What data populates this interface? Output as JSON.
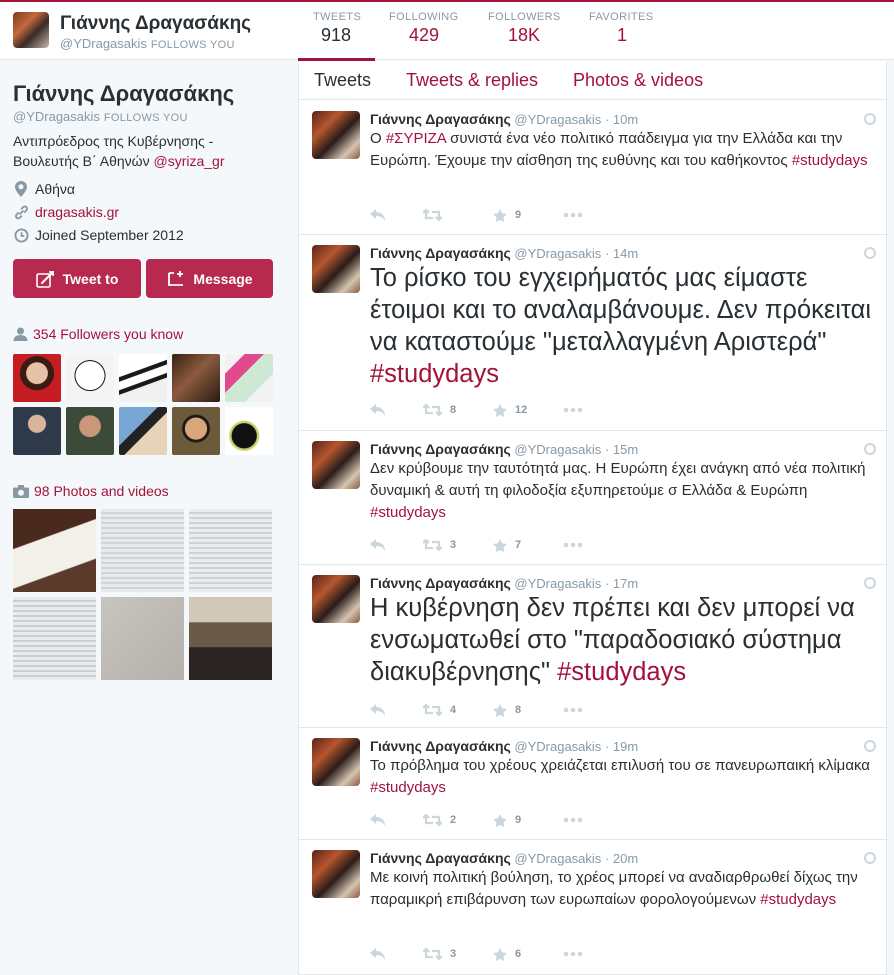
{
  "header": {
    "name": "Γιάννης Δραγασάκης",
    "handle": "@YDragasakis",
    "follows_you": "FOLLOWS YOU",
    "stats": [
      {
        "label": "TWEETS",
        "value": "918"
      },
      {
        "label": "FOLLOWING",
        "value": "429"
      },
      {
        "label": "FOLLOWERS",
        "value": "18K"
      },
      {
        "label": "FAVORITES",
        "value": "1"
      }
    ]
  },
  "profile": {
    "name": "Γιάννης Δραγασάκης",
    "handle": "@YDragasakis",
    "follows_you": "FOLLOWS YOU",
    "bio_line1": "Αντιπρόεδρος της Κυβέρνησης -",
    "bio_line2": "Βουλευτής Β΄ Αθηνών",
    "bio_mention": "@syriza_gr",
    "location": "Αθήνα",
    "website": "dragasakis.gr",
    "joined": "Joined September 2012",
    "tweet_to_label": "Tweet to",
    "message_label": "Message",
    "followers_you_know": "354 Followers you know",
    "photos_videos": "98 Photos and videos"
  },
  "tabs": [
    {
      "label": "Tweets"
    },
    {
      "label": "Tweets & replies"
    },
    {
      "label": "Photos & videos"
    }
  ],
  "tweets": [
    {
      "name": "Γιάννης Δραγασάκης",
      "handle": "@YDragasakis",
      "time": "· 10m",
      "parts": [
        "Ο ",
        "#ΣΥΡΙΖΑ",
        " συνιστά ένα νέο πολιτικό παάδειγμα για την Ελλάδα και την Ευρώπη. Έχουμε την αίσθηση της ευθύνης και του καθήκοντος ",
        "#studydays"
      ],
      "retweets": "",
      "favorites": "9"
    },
    {
      "name": "Γιάννης Δραγασάκης",
      "handle": "@YDragasakis",
      "time": "· 14m",
      "parts": [
        "Το ρίσκο του εγχειρήματός μας είμαστε έτοιμοι και το αναλαμβάνουμε. Δεν πρόκειται να καταστούμε \"μεταλλαγμένη Αριστερά\" ",
        "#studydays"
      ],
      "retweets": "8",
      "favorites": "12"
    },
    {
      "name": "Γιάννης Δραγασάκης",
      "handle": "@YDragasakis",
      "time": "· 15m",
      "parts": [
        "Δεν κρύβουμε την ταυτότητά μας. Η Ευρώπη έχει ανάγκη από νέα πολιτική δυναμική & αυτή τη φιλοδοξία εξυπηρετούμε σ Ελλάδα & Ευρώπη ",
        "#studydays"
      ],
      "retweets": "3",
      "favorites": "7"
    },
    {
      "name": "Γιάννης Δραγασάκης",
      "handle": "@YDragasakis",
      "time": "· 17m",
      "parts": [
        "Η κυβέρνηση δεν πρέπει και δεν μπορεί να ενσωματωθεί στο \"παραδοσιακό σύστημα διακυβέρνησης\" ",
        "#studydays"
      ],
      "retweets": "4",
      "favorites": "8"
    },
    {
      "name": "Γιάννης Δραγασάκης",
      "handle": "@YDragasakis",
      "time": "· 19m",
      "parts": [
        "Το πρόβλημα του χρέους χρειάζεται επιλυσή του σε πανευρωπαική κλίμακα ",
        "#studydays"
      ],
      "retweets": "2",
      "favorites": "9"
    },
    {
      "name": "Γιάννης Δραγασάκης",
      "handle": "@YDragasakis",
      "time": "· 20m",
      "parts": [
        "Με κοινή πολιτική βούληση, το χρέος μπορεί να αναδιαρθρωθεί δίχως την παραμικρή επιβάρυνση των ευρωπαίων φορολογούμενων ",
        "#studydays"
      ],
      "retweets": "3",
      "favorites": "6"
    }
  ],
  "colors": {
    "accent": "#a3123a",
    "button": "#b8294f",
    "muted": "#8899a6"
  }
}
